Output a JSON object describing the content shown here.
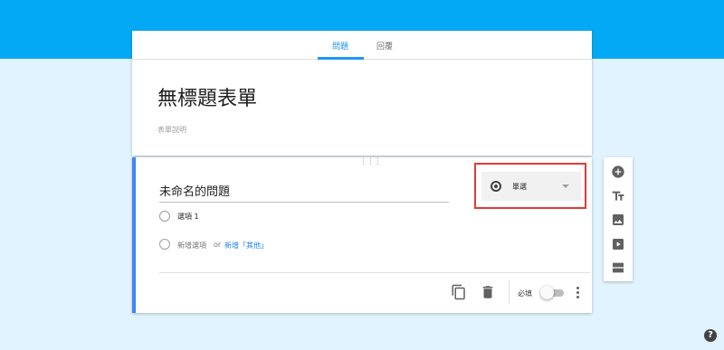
{
  "tabs": [
    {
      "label": "問題",
      "active": true
    },
    {
      "label": "回覆",
      "active": false
    }
  ],
  "form": {
    "title": "無標題表單",
    "description_placeholder": "表單說明"
  },
  "question": {
    "title_placeholder": "未命名的問題",
    "options": [
      {
        "label": "選項 1"
      }
    ],
    "add_option_label": "新增選項",
    "or_label": "or",
    "add_other_label": "新增「其他」",
    "type_label": "單選",
    "type_icon": "radio-button-icon",
    "required_label": "必填",
    "required": false
  },
  "toolbar": {
    "icons": [
      "add-question-icon",
      "title-text-icon",
      "image-icon",
      "video-icon",
      "section-icon"
    ]
  },
  "colors": {
    "brand": "#03a9f4",
    "background": "#e0f3fe",
    "accent": "#4285f4",
    "highlight_box": "#e53935"
  }
}
